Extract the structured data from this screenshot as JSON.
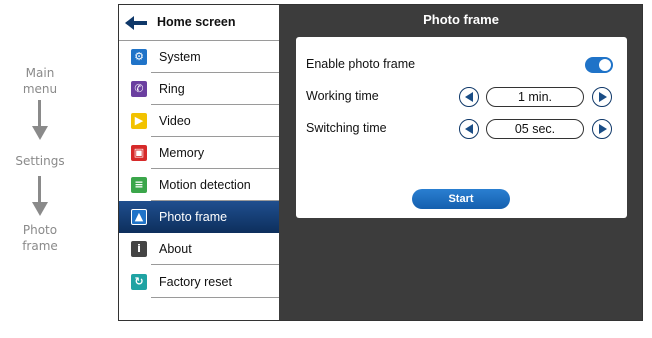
{
  "flow": {
    "steps": [
      "Main\nmenu",
      "Settings",
      "Photo\nframe"
    ]
  },
  "sidebar": {
    "header_label": "Home screen",
    "items": [
      {
        "label": "System",
        "icon": "gear-icon",
        "color": "#1f73c8"
      },
      {
        "label": "Ring",
        "icon": "phone-icon",
        "color": "#6b3fa0"
      },
      {
        "label": "Video",
        "icon": "play-icon",
        "color": "#f2c200"
      },
      {
        "label": "Memory",
        "icon": "memory-icon",
        "color": "#d62a2a"
      },
      {
        "label": "Motion detection",
        "icon": "motion-icon",
        "color": "#3aa64a"
      },
      {
        "label": "Photo frame",
        "icon": "picture-icon",
        "color": "#1f73c8"
      },
      {
        "label": "About",
        "icon": "info-icon",
        "color": "#444444"
      },
      {
        "label": "Factory reset",
        "icon": "reset-icon",
        "color": "#1fa3a3"
      }
    ],
    "active_index": 5
  },
  "panel": {
    "title": "Photo frame",
    "enable_label": "Enable photo frame",
    "enable_on": true,
    "working_time_label": "Working time",
    "working_time_value": "1 min.",
    "switching_time_label": "Switching time",
    "switching_time_value": "05 sec.",
    "start_label": "Start"
  },
  "colors": {
    "accent": "#1f73c8",
    "active_item": "#0d2f5c",
    "screen_bg": "#3c3c3c"
  }
}
